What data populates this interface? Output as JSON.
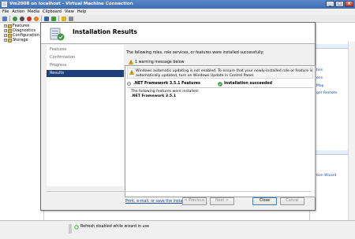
{
  "window": {
    "title": "Vm2008 on localhost - Virtual Machine Connection",
    "minimize": "_",
    "maximize": "□",
    "close": "X"
  },
  "menu": [
    "File",
    "Action",
    "Media",
    "Clipboard",
    "View",
    "Help"
  ],
  "toolbar": {
    "icons": [
      "ctrl-alt-del-icon",
      "start-icon",
      "turn-off-icon",
      "shutdown-icon",
      "save-state-icon",
      "pause-icon",
      "resume-icon",
      "snapshot-icon",
      "revert-icon"
    ],
    "colors": {
      "green": "#3a9a3a",
      "red": "#d03020",
      "orange": "#e08020",
      "blue": "#3060b0",
      "yellow": "#e0b020"
    }
  },
  "tree": [
    {
      "label": "Features",
      "expander": "+"
    },
    {
      "label": "Diagnostics",
      "expander": "+"
    },
    {
      "label": "Configuration",
      "expander": "+"
    },
    {
      "label": "Storage",
      "expander": "+"
    }
  ],
  "actions": [
    "ties",
    "ons",
    "Map",
    "ger Remote",
    "tion Wizard"
  ],
  "wizard": {
    "title": "Installation Results",
    "steps": [
      "Features",
      "Confirmation",
      "Progress",
      "Results"
    ],
    "active_step": 3,
    "intro": "The following roles, role services, or features were installed successfully:",
    "warning_count": "1 warning message below",
    "warning_line1": "Windows automatic updating is not enabled. To ensure that your newly-installed role or feature is",
    "warning_line2": "automatically updated, turn on Windows Update in Control Panel.",
    "feature_name": ".NET Framework 3.5.1 Features",
    "feature_status": "Installation succeeded",
    "installed_label": "The following features were installed:",
    "installed_item": ".NET Framework 3.5.1",
    "report_link": "Print, e-mail, or save the installation report",
    "buttons": {
      "previous": "< Previous",
      "next": "Next >",
      "close": "Close",
      "cancel": "Cancel"
    },
    "colors": {
      "nav_active": "#1f3f7a",
      "link": "#1a4aa0",
      "success": "#3a9a3a",
      "warning": "#e8c020"
    }
  },
  "status": {
    "text": "Refresh disabled while wizard in use"
  }
}
